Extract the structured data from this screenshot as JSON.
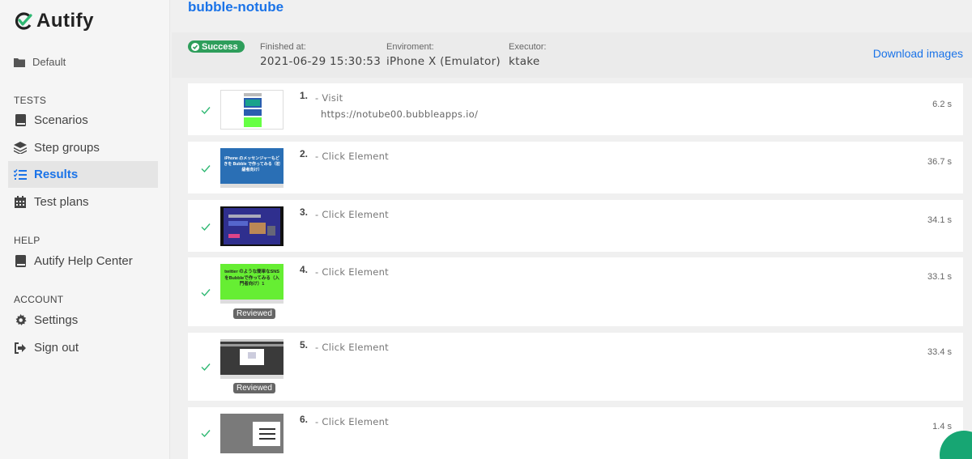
{
  "app": {
    "name": "Autify"
  },
  "sidebar": {
    "project": "Default",
    "sections": [
      {
        "title": "TESTS",
        "items": [
          {
            "label": "Scenarios",
            "icon": "book-icon",
            "active": false
          },
          {
            "label": "Step groups",
            "icon": "layers-icon",
            "active": false
          },
          {
            "label": "Results",
            "icon": "list-check-icon",
            "active": true
          },
          {
            "label": "Test plans",
            "icon": "calendar-icon",
            "active": false
          }
        ]
      },
      {
        "title": "HELP",
        "items": [
          {
            "label": "Autify Help Center",
            "icon": "book-icon",
            "active": false
          }
        ]
      },
      {
        "title": "ACCOUNT",
        "items": [
          {
            "label": "Settings",
            "icon": "gear-icon",
            "active": false
          },
          {
            "label": "Sign out",
            "icon": "sign-out-icon",
            "active": false
          }
        ]
      }
    ]
  },
  "result": {
    "title": "bubble-notube",
    "status": "Success",
    "finished_label": "Finished at:",
    "finished_value": "2021-06-29 15:30:53",
    "environment_label": "Enviroment:",
    "environment_value": "iPhone X (Emulator)",
    "executor_label": "Executor:",
    "executor_value": "ktake",
    "download_label": "Download images"
  },
  "steps": [
    {
      "num": "1.",
      "action": "- Visit",
      "url": "https://notube00.bubbleapps.io/",
      "time": "6.2 s",
      "reviewed": ""
    },
    {
      "num": "2.",
      "action": "- Click Element",
      "url": "",
      "time": "36.7 s",
      "reviewed": ""
    },
    {
      "num": "3.",
      "action": "- Click Element",
      "url": "",
      "time": "34.1 s",
      "reviewed": ""
    },
    {
      "num": "4.",
      "action": "- Click Element",
      "url": "",
      "time": "33.1 s",
      "reviewed": "Reviewed"
    },
    {
      "num": "5.",
      "action": "- Click Element",
      "url": "",
      "time": "33.4 s",
      "reviewed": "Reviewed"
    },
    {
      "num": "6.",
      "action": "- Click Element",
      "url": "",
      "time": "1.4 s",
      "reviewed": ""
    }
  ],
  "thumb_texts": {
    "step2": "iPhone のメッセンジャーもどきを Bubble で作ってみる（初級者向け）",
    "step4": "twitter のような簡単なSNSをBubbleで作ってみる（入門者向け）1"
  },
  "colors": {
    "accent": "#1a73e8",
    "success": "#2e9e5b",
    "check": "#2eb872"
  }
}
